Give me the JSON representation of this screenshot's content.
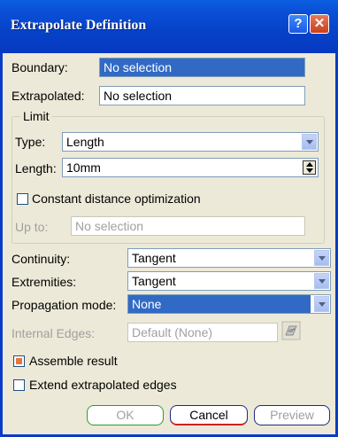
{
  "window": {
    "title": "Extrapolate Definition",
    "help_glyph": "?",
    "close_glyph": "✕"
  },
  "boundary": {
    "label": "Boundary:",
    "value": "No selection"
  },
  "extrapolated": {
    "label": "Extrapolated:",
    "value": "No selection"
  },
  "limit": {
    "legend": "Limit",
    "type": {
      "label": "Type:",
      "value": "Length"
    },
    "length": {
      "label": "Length:",
      "value": "10mm"
    },
    "constant_distance": {
      "label": "Constant distance optimization",
      "checked": false
    },
    "up_to": {
      "label": "Up to:",
      "value": "No selection"
    }
  },
  "continuity": {
    "label": "Continuity:",
    "value": "Tangent"
  },
  "extremities": {
    "label": "Extremities:",
    "value": "Tangent"
  },
  "propagation": {
    "label": "Propagation mode:",
    "value": "None"
  },
  "internal_edges": {
    "label": "Internal Edges:",
    "value": "Default (None)",
    "icon": "edge-selector-icon"
  },
  "assemble_result": {
    "label": "Assemble result",
    "checked": true
  },
  "extend_edges": {
    "label": "Extend extrapolated edges",
    "checked": false
  },
  "buttons": {
    "ok": "OK",
    "cancel": "Cancel",
    "preview": "Preview"
  },
  "colors": {
    "title_bar": "#0a50d8",
    "selection": "#316ac5",
    "checked_box": "#e8733d"
  }
}
